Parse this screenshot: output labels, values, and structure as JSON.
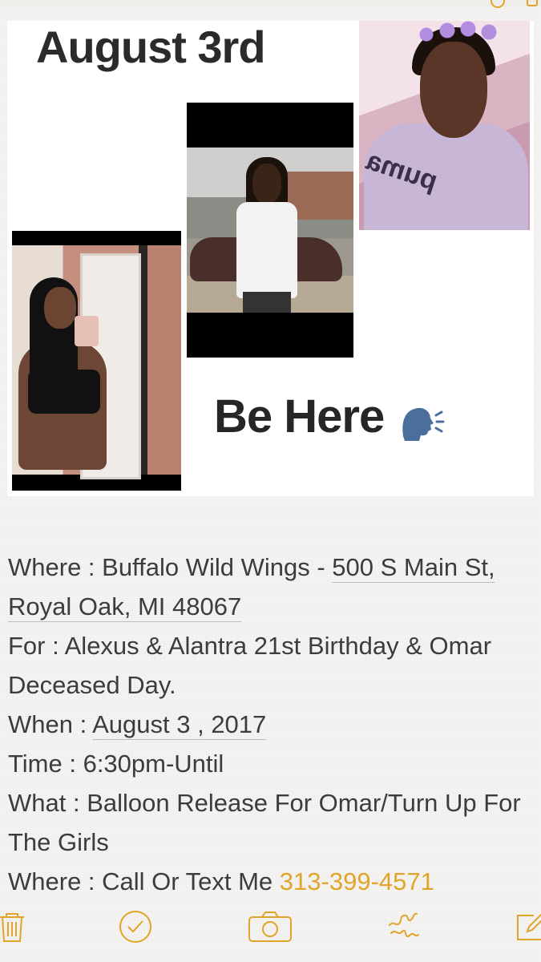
{
  "collage": {
    "title": "August 3rd",
    "slogan": "Be Here",
    "slogan_icon": "speaking-head-icon",
    "photos": [
      "woman-mirror-selfie",
      "man-in-white-shirt",
      "woman-purple-hoodie"
    ],
    "hoodie_logo_text": "puma"
  },
  "note": {
    "lines": [
      {
        "label": "Where : Buffalo Wild Wings - ",
        "link": "500 S Main St, Royal Oak, MI 48067"
      },
      {
        "label": "For : Alexus & Alantra 21st Birthday & Omar Deceased Day."
      },
      {
        "label": "When : ",
        "link": "August 3 , 2017"
      },
      {
        "label": "Time : 6:30pm-Until"
      },
      {
        "label": "What : Balloon Release For Omar/Turn Up For The Girls"
      },
      {
        "label": "Where : Call Or Text Me ",
        "phone": "313-399-4571"
      }
    ]
  },
  "toolbar": {
    "buttons": [
      "trash-icon",
      "checklist-icon",
      "camera-icon",
      "sketch-icon",
      "compose-icon"
    ],
    "accent": "#e0a52a"
  }
}
